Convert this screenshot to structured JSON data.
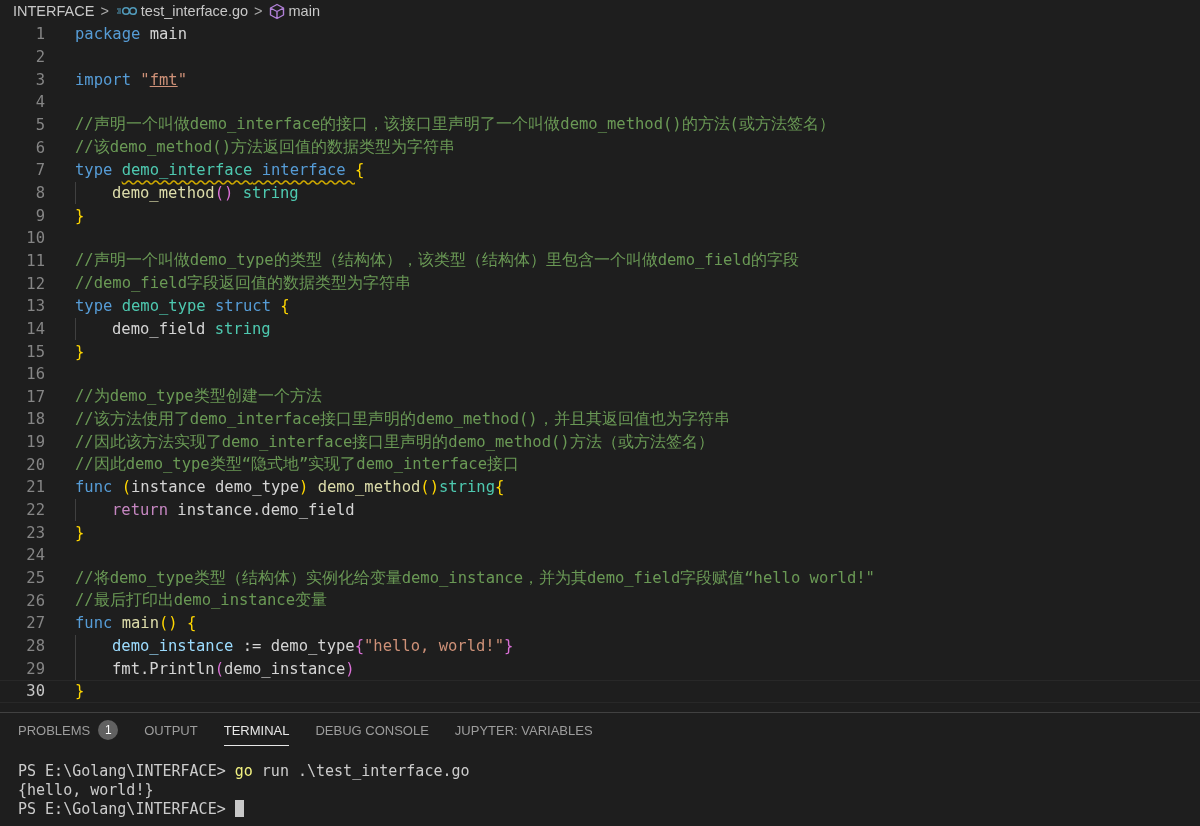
{
  "breadcrumbs": {
    "folder": "INTERFACE",
    "file": "test_interface.go",
    "symbol": "main",
    "separator": ">"
  },
  "editor": {
    "lines": [
      {
        "number": "1",
        "indented": false,
        "current": false,
        "tokens": [
          {
            "kind": "kw",
            "text": "package "
          },
          {
            "kind": "txt",
            "text": "main"
          }
        ]
      },
      {
        "number": "2",
        "indented": false,
        "current": false
      },
      {
        "number": "3",
        "indented": false,
        "current": false,
        "tokens": [
          {
            "kind": "kw",
            "text": "import "
          },
          {
            "kind": "str",
            "text": "\""
          },
          {
            "kind": "link",
            "text": "fmt"
          },
          {
            "kind": "str",
            "text": "\""
          }
        ]
      },
      {
        "number": "4",
        "indented": false,
        "current": false
      },
      {
        "number": "5",
        "indented": false,
        "current": false,
        "tokens": [
          {
            "kind": "com",
            "text": "//声明一个叫做demo_interface的接口，该接口里声明了一个叫做demo_method()的方法(或方法签名）"
          }
        ]
      },
      {
        "number": "6",
        "indented": false,
        "current": false,
        "tokens": [
          {
            "kind": "com",
            "text": "//该demo_method()方法返回值的数据类型为字符串"
          }
        ]
      },
      {
        "number": "7",
        "indented": false,
        "current": false,
        "tokens": [
          {
            "kind": "kw",
            "text": "type "
          },
          {
            "kind": "type-warn",
            "text": "demo_interface"
          },
          {
            "kind": "kw-warn",
            "text": " interface "
          },
          {
            "kind": "brace",
            "text": "{"
          }
        ]
      },
      {
        "number": "8",
        "indented": true,
        "current": false,
        "tokens": [
          {
            "kind": "fn",
            "text": "demo_method"
          },
          {
            "kind": "paren",
            "text": "()"
          },
          {
            "kind": "type",
            "text": " string"
          }
        ]
      },
      {
        "number": "9",
        "indented": false,
        "current": false,
        "tokens": [
          {
            "kind": "brace",
            "text": "}"
          }
        ]
      },
      {
        "number": "10",
        "indented": false,
        "current": false
      },
      {
        "number": "11",
        "indented": false,
        "current": false,
        "tokens": [
          {
            "kind": "com",
            "text": "//声明一个叫做demo_type的类型（结构体），该类型（结构体）里包含一个叫做demo_field的字段"
          }
        ]
      },
      {
        "number": "12",
        "indented": false,
        "current": false,
        "tokens": [
          {
            "kind": "com",
            "text": "//demo_field字段返回值的数据类型为字符串"
          }
        ]
      },
      {
        "number": "13",
        "indented": false,
        "current": false,
        "tokens": [
          {
            "kind": "kw",
            "text": "type "
          },
          {
            "kind": "type",
            "text": "demo_type "
          },
          {
            "kind": "kw",
            "text": "struct "
          },
          {
            "kind": "brace",
            "text": "{"
          }
        ]
      },
      {
        "number": "14",
        "indented": true,
        "current": false,
        "tokens": [
          {
            "kind": "txt",
            "text": "demo_field "
          },
          {
            "kind": "type",
            "text": "string"
          }
        ]
      },
      {
        "number": "15",
        "indented": false,
        "current": false,
        "tokens": [
          {
            "kind": "brace",
            "text": "}"
          }
        ]
      },
      {
        "number": "16",
        "indented": false,
        "current": false
      },
      {
        "number": "17",
        "indented": false,
        "current": false,
        "tokens": [
          {
            "kind": "com",
            "text": "//为demo_type类型创建一个方法"
          }
        ]
      },
      {
        "number": "18",
        "indented": false,
        "current": false,
        "tokens": [
          {
            "kind": "com",
            "text": "//该方法使用了demo_interface接口里声明的demo_method()，并且其返回值也为字符串"
          }
        ]
      },
      {
        "number": "19",
        "indented": false,
        "current": false,
        "tokens": [
          {
            "kind": "com",
            "text": "//因此该方法实现了demo_interface接口里声明的demo_method()方法（或方法签名）"
          }
        ]
      },
      {
        "number": "20",
        "indented": false,
        "current": false,
        "tokens": [
          {
            "kind": "com",
            "text": "//因此demo_type类型“隐式地”实现了demo_interface接口"
          }
        ]
      },
      {
        "number": "21",
        "indented": false,
        "current": false,
        "tokens": [
          {
            "kind": "kw",
            "text": "func "
          },
          {
            "kind": "brace",
            "text": "("
          },
          {
            "kind": "txt",
            "text": "instance demo_type"
          },
          {
            "kind": "brace",
            "text": ") "
          },
          {
            "kind": "fn",
            "text": "demo_method"
          },
          {
            "kind": "brace",
            "text": "()"
          },
          {
            "kind": "type",
            "text": "string"
          },
          {
            "kind": "brace",
            "text": "{"
          }
        ]
      },
      {
        "number": "22",
        "indented": true,
        "current": false,
        "tokens": [
          {
            "kind": "ctrl",
            "text": "return "
          },
          {
            "kind": "txt",
            "text": "instance.demo_field"
          }
        ]
      },
      {
        "number": "23",
        "indented": false,
        "current": false,
        "tokens": [
          {
            "kind": "brace",
            "text": "}"
          }
        ]
      },
      {
        "number": "24",
        "indented": false,
        "current": false
      },
      {
        "number": "25",
        "indented": false,
        "current": false,
        "tokens": [
          {
            "kind": "com",
            "text": "//将demo_type类型（结构体）实例化给变量demo_instance，并为其demo_field字段赋值“hello world!\""
          }
        ]
      },
      {
        "number": "26",
        "indented": false,
        "current": false,
        "tokens": [
          {
            "kind": "com",
            "text": "//最后打印出demo_instance变量"
          }
        ]
      },
      {
        "number": "27",
        "indented": false,
        "current": false,
        "tokens": [
          {
            "kind": "kw",
            "text": "func "
          },
          {
            "kind": "fn",
            "text": "main"
          },
          {
            "kind": "brace",
            "text": "() {"
          }
        ]
      },
      {
        "number": "28",
        "indented": true,
        "current": false,
        "tokens": [
          {
            "kind": "var",
            "text": "demo_instance"
          },
          {
            "kind": "txt",
            "text": " := demo_type"
          },
          {
            "kind": "paren",
            "text": "{"
          },
          {
            "kind": "str",
            "text": "\"hello, world!\""
          },
          {
            "kind": "paren",
            "text": "}"
          }
        ]
      },
      {
        "number": "29",
        "indented": true,
        "current": false,
        "tokens": [
          {
            "kind": "txt",
            "text": "fmt.Println"
          },
          {
            "kind": "paren",
            "text": "("
          },
          {
            "kind": "txt",
            "text": "demo_instance"
          },
          {
            "kind": "paren",
            "text": ")"
          }
        ]
      },
      {
        "number": "30",
        "indented": false,
        "current": true,
        "tokens": [
          {
            "kind": "brace",
            "text": "}"
          }
        ]
      }
    ]
  },
  "panel": {
    "tabs": [
      {
        "label": "PROBLEMS",
        "badge": "1",
        "selected": false
      },
      {
        "label": "OUTPUT",
        "selected": false
      },
      {
        "label": "TERMINAL",
        "selected": true
      },
      {
        "label": "DEBUG CONSOLE",
        "selected": false
      },
      {
        "label": "JUPYTER: VARIABLES",
        "selected": false
      }
    ],
    "terminal": [
      {
        "prompt": "PS E:\\Golang\\INTERFACE> ",
        "command": "go",
        "args": " run .\\test_interface.go",
        "cursor": false
      },
      {
        "output": "{hello, world!}"
      },
      {
        "prompt": "PS E:\\Golang\\INTERFACE> ",
        "cursor": true
      }
    ]
  }
}
